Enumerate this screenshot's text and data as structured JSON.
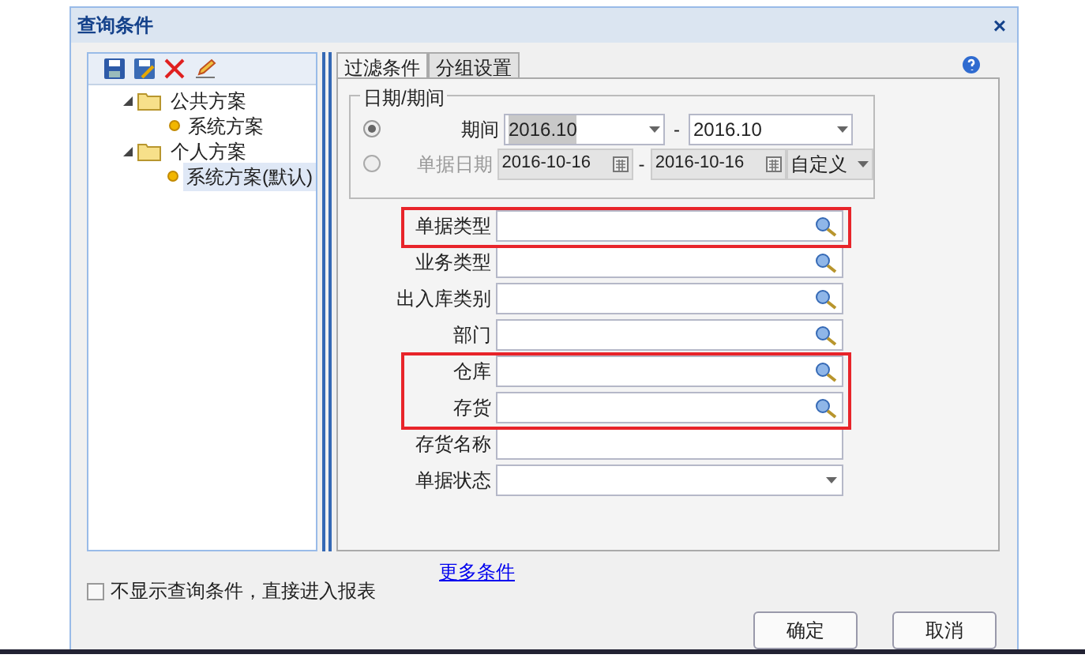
{
  "window": {
    "title": "查询条件",
    "close": "×"
  },
  "tree": [
    {
      "label": "公共方案",
      "expanded": true,
      "selected": false,
      "children": [
        {
          "label": "系统方案",
          "selected": false
        }
      ]
    },
    {
      "label": "个人方案",
      "expanded": true,
      "selected": false,
      "children": [
        {
          "label": "系统方案(默认)",
          "selected": true
        }
      ]
    }
  ],
  "tabs": [
    {
      "label": "过滤条件",
      "selected": true
    },
    {
      "label": "分组设置",
      "selected": false
    }
  ],
  "date_group": {
    "title": "日期/期间",
    "period": {
      "selected": true,
      "label": "期间",
      "from": "2016.10",
      "to": "2016.10",
      "separator": "-"
    },
    "date": {
      "selected": false,
      "disabled": true,
      "label": "单据日期",
      "from": "2016-10-16",
      "to": "2016-10-16",
      "separator": "-",
      "range": "自定义"
    }
  },
  "fields": [
    {
      "label": "单据类型",
      "kind": "lookup",
      "highlighted": true
    },
    {
      "label": "业务类型",
      "kind": "lookup",
      "highlighted": false
    },
    {
      "label": "出入库类别",
      "kind": "lookup",
      "highlighted": false
    },
    {
      "label": "部门",
      "kind": "lookup",
      "highlighted": false
    },
    {
      "label": "仓库",
      "kind": "lookup",
      "highlighted": true
    },
    {
      "label": "存货",
      "kind": "lookup",
      "highlighted": true
    },
    {
      "label": "存货名称",
      "kind": "text",
      "highlighted": false
    },
    {
      "label": "单据状态",
      "kind": "select",
      "highlighted": false
    }
  ],
  "more_link": "更多条件",
  "skip_option": {
    "label": "不显示查询条件，直接进入报表",
    "checked": false
  },
  "buttons": [
    "确定",
    "取消"
  ]
}
